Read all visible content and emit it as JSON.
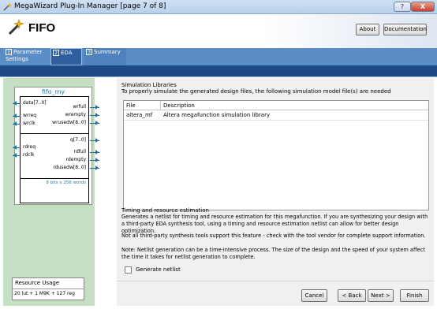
{
  "window": {
    "title": "MegaWizard Plug-In Manager [page 7 of 8]",
    "help_label": "?",
    "close_label": "X"
  },
  "header": {
    "title": "FIFO",
    "about_label": "About",
    "documentation_label": "Documentation"
  },
  "tabs": [
    {
      "num": "1",
      "label": "Parameter Settings"
    },
    {
      "num": "2",
      "label": "EDA"
    },
    {
      "num": "3",
      "label": "Summary"
    }
  ],
  "symbol": {
    "name": "fifo_my",
    "left_pins": [
      "data[7..0]",
      "wrreq",
      "wrclk",
      "rdreq",
      "rdclk"
    ],
    "right_pins": [
      "wrfull",
      "wrempty",
      "wrusedw[8..0]",
      "q[7..0]",
      "rdfull",
      "rdempty",
      "rdusedw[8..0]"
    ],
    "size_label": "8 bits x 256 words"
  },
  "resource": {
    "title": "Resource Usage",
    "value": "20 lut + 1 M9K + 127 reg"
  },
  "simulation": {
    "title": "Simulation Libraries",
    "hint": "To properly simulate the generated design files, the following simulation model file(s) are needed",
    "columns": [
      "File",
      "Description"
    ],
    "rows": [
      {
        "file": "altera_mf",
        "description": "Altera megafunction simulation library"
      }
    ]
  },
  "timing": {
    "title": "Timing and resource estimation",
    "para1": "Generates a netlist for timing and resource estimation for this megafunction. If you are synthesizing your design with a third-party EDA synthesis tool, using a timing and resource estimation netlist can allow for better design optimization.",
    "para2": "Not all third-party synthesis tools support this feature - check with the tool vendor for complete support information.",
    "para3": "Note: Netlist generation can be a time-intensive process. The size of the design and the speed of your system affect the time it takes for netlist generation to complete.",
    "checkbox_label": "Generate netlist"
  },
  "footer": {
    "cancel": "Cancel",
    "back": "< Back",
    "next": "Next >",
    "finish": "Finish"
  }
}
